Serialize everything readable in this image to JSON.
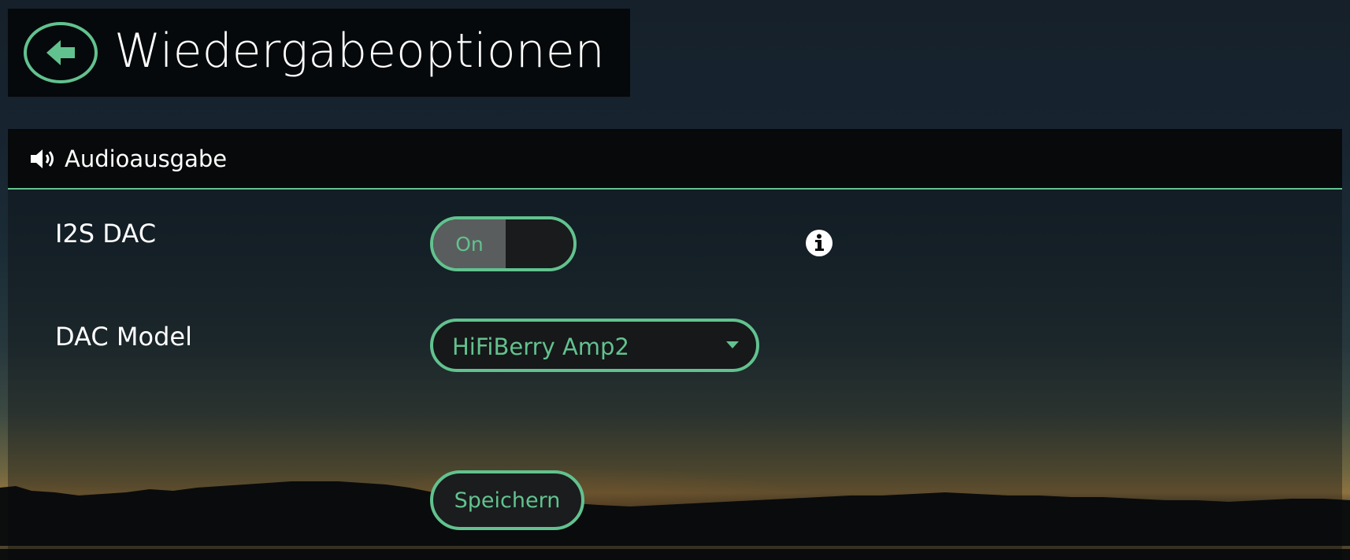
{
  "header": {
    "title": "Wiedergabeoptionen",
    "back_icon": "arrow-left-circle-icon"
  },
  "section": {
    "icon": "speaker-volume-icon",
    "title": "Audioausgabe"
  },
  "settings": {
    "i2s_dac": {
      "label": "I2S DAC",
      "toggle_on_label": "On",
      "state": "on",
      "info_icon": "info-circle-icon"
    },
    "dac_model": {
      "label": "DAC Model",
      "selected": "HiFiBerry Amp2",
      "dropdown_icon": "caret-down-icon"
    }
  },
  "actions": {
    "save_label": "Speichern"
  },
  "colors": {
    "accent": "#62c28f",
    "header_bg": "#06090b",
    "text": "#ffffff"
  }
}
